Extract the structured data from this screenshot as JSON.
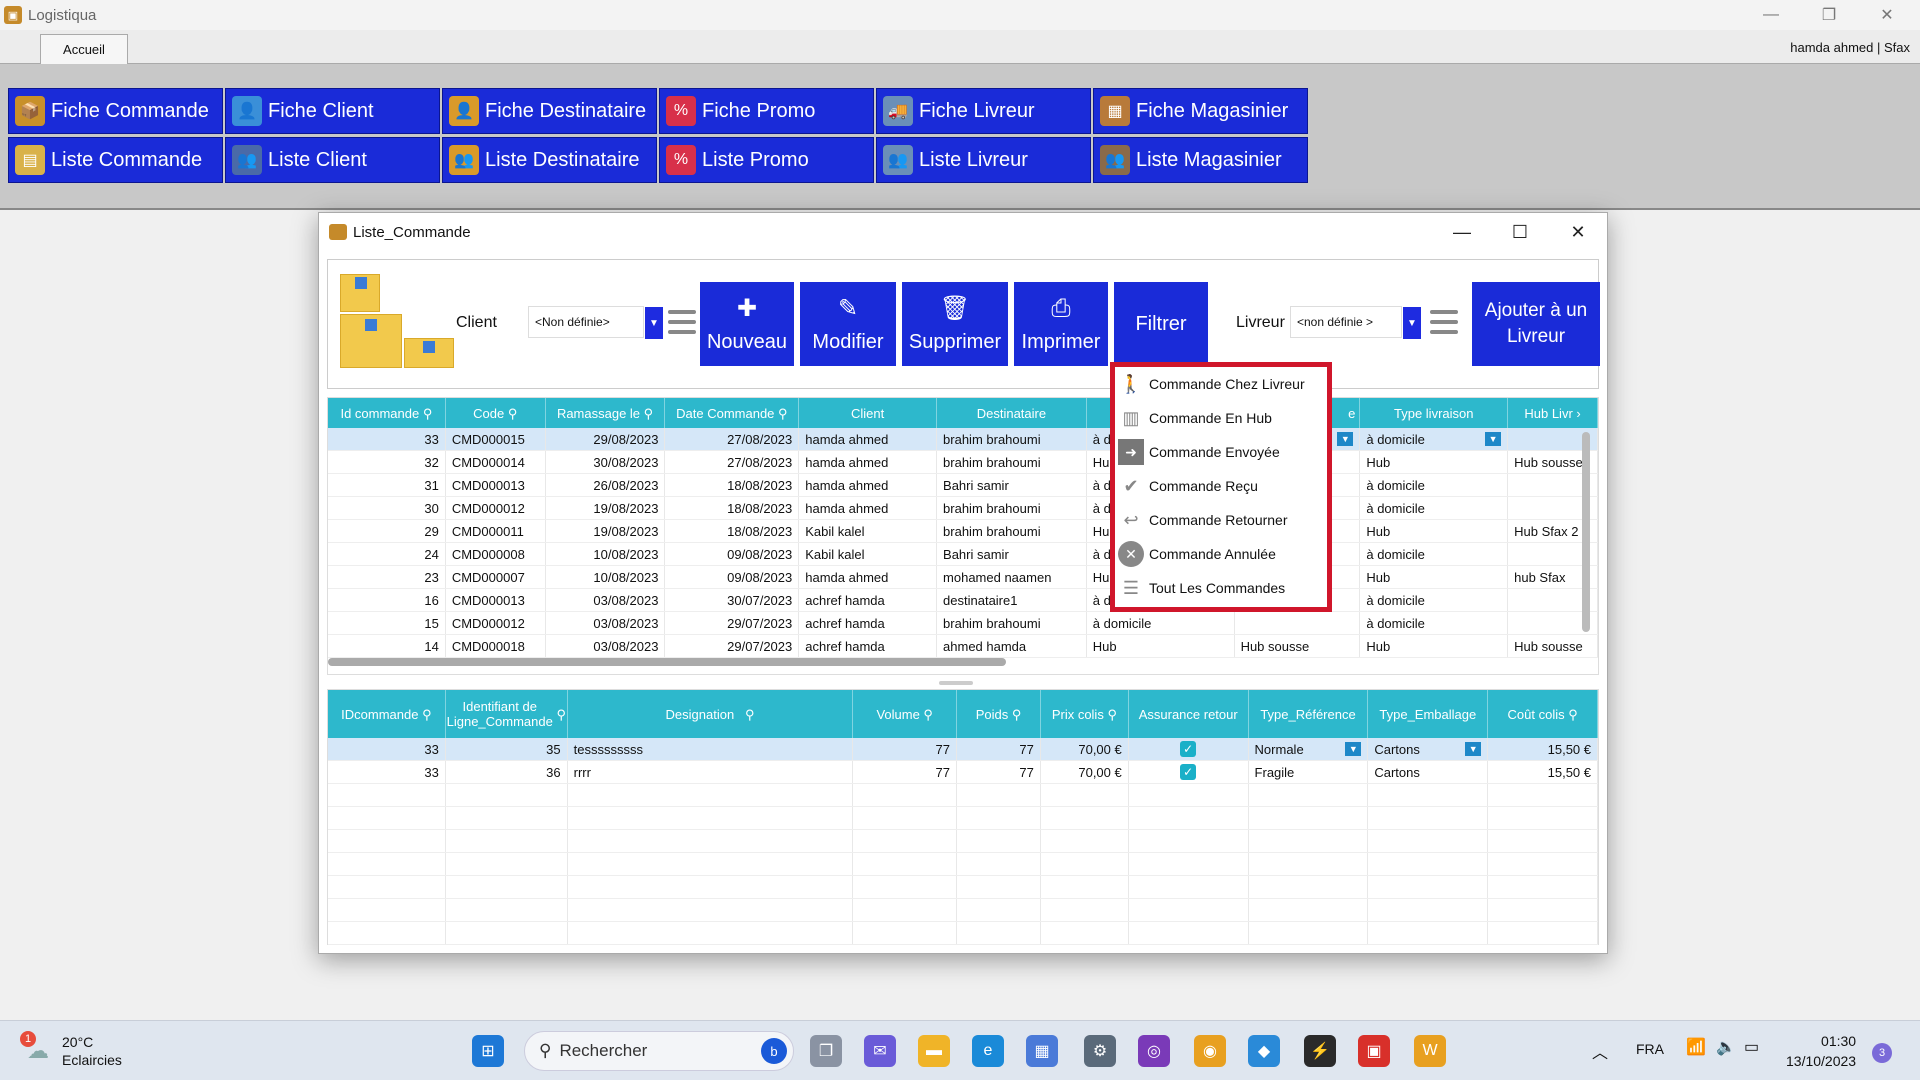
{
  "app": {
    "title": "Logistiqua",
    "tab": "Accueil",
    "user": "hamda ahmed | Sfax"
  },
  "ribbon": {
    "row1": [
      "Fiche Commande",
      "Fiche Client",
      "Fiche Destinataire",
      "Fiche Promo",
      "Fiche Livreur",
      "Fiche Magasinier"
    ],
    "row2": [
      "Liste Commande",
      "Liste Client",
      "Liste Destinataire",
      "Liste Promo",
      "Liste Livreur",
      "Liste Magasinier"
    ]
  },
  "window": {
    "title": "Liste_Commande"
  },
  "toolbar": {
    "client_label": "Client",
    "client_value": "<Non définie>",
    "livreur_label": "Livreur",
    "livreur_value": "<non définie >",
    "nouveau": "Nouveau",
    "modifier": "Modifier",
    "supprimer": "Supprimer",
    "imprimer": "Imprimer",
    "filtrer": "Filtrer",
    "ajouter_line1": "Ajouter à un",
    "ajouter_line2": "Livreur"
  },
  "orders": {
    "headers": [
      "Id commande",
      "Code",
      "Ramassage le",
      "Date Commande",
      "Client",
      "Destinataire",
      "",
      "",
      "Type livraison",
      "Hub Livr"
    ],
    "header_e": "e",
    "rows": [
      {
        "id": "33",
        "code": "CMD000015",
        "ram": "29/08/2023",
        "date": "27/08/2023",
        "client": "hamda ahmed",
        "dest": "brahim brahoumi",
        "c7": "à do",
        "c8": "",
        "type": "à domicile",
        "hub": ""
      },
      {
        "id": "32",
        "code": "CMD000014",
        "ram": "30/08/2023",
        "date": "27/08/2023",
        "client": "hamda ahmed",
        "dest": "brahim brahoumi",
        "c7": "Hub",
        "c8": "",
        "type": "Hub",
        "hub": "Hub sousse"
      },
      {
        "id": "31",
        "code": "CMD000013",
        "ram": "26/08/2023",
        "date": "18/08/2023",
        "client": "hamda ahmed",
        "dest": "Bahri samir",
        "c7": "à do",
        "c8": "",
        "type": "à domicile",
        "hub": ""
      },
      {
        "id": "30",
        "code": "CMD000012",
        "ram": "19/08/2023",
        "date": "18/08/2023",
        "client": "hamda ahmed",
        "dest": "brahim brahoumi",
        "c7": "à do",
        "c8": "",
        "type": "à domicile",
        "hub": ""
      },
      {
        "id": "29",
        "code": "CMD000011",
        "ram": "19/08/2023",
        "date": "18/08/2023",
        "client": "Kabil kalel",
        "dest": "brahim brahoumi",
        "c7": "Hub",
        "c8": "",
        "type": "Hub",
        "hub": "Hub Sfax 2"
      },
      {
        "id": "24",
        "code": "CMD000008",
        "ram": "10/08/2023",
        "date": "09/08/2023",
        "client": "Kabil kalel",
        "dest": "Bahri samir",
        "c7": "à do",
        "c8": "",
        "type": "à domicile",
        "hub": ""
      },
      {
        "id": "23",
        "code": "CMD000007",
        "ram": "10/08/2023",
        "date": "09/08/2023",
        "client": "hamda ahmed",
        "dest": "mohamed naamen",
        "c7": "Hub",
        "c8": "",
        "type": "Hub",
        "hub": "hub Sfax"
      },
      {
        "id": "16",
        "code": "CMD000013",
        "ram": "03/08/2023",
        "date": "30/07/2023",
        "client": "achref hamda",
        "dest": "destinataire1",
        "c7": "à do",
        "c8": "",
        "type": "à domicile",
        "hub": ""
      },
      {
        "id": "15",
        "code": "CMD000012",
        "ram": "03/08/2023",
        "date": "29/07/2023",
        "client": "achref hamda",
        "dest": "brahim brahoumi",
        "c7": "à domicile",
        "c8": "",
        "type": "à domicile",
        "hub": ""
      },
      {
        "id": "14",
        "code": "CMD000018",
        "ram": "03/08/2023",
        "date": "29/07/2023",
        "client": "achref hamda",
        "dest": "ahmed hamda",
        "c7": "Hub",
        "c8": "Hub sousse",
        "type": "Hub",
        "hub": "Hub sousse"
      }
    ]
  },
  "lines": {
    "headers": [
      "IDcommande",
      "Identifiant de Ligne_Commande",
      "Designation",
      "Volume",
      "Poids",
      "Prix colis",
      "Assurance retour",
      "Type_Référence",
      "Type_Emballage",
      "Coût colis"
    ],
    "rows": [
      {
        "id": "33",
        "ligne": "35",
        "des": "tesssssssss",
        "vol": "77",
        "poids": "77",
        "prix": "70,00 €",
        "ref": "Normale",
        "emb": "Cartons",
        "cout": "15,50 €"
      },
      {
        "id": "33",
        "ligne": "36",
        "des": "rrrr",
        "vol": "77",
        "poids": "77",
        "prix": "70,00 €",
        "ref": "Fragile",
        "emb": "Cartons",
        "cout": "15,50 €"
      }
    ]
  },
  "filter_menu": [
    "Commande Chez Livreur",
    "Commande En Hub",
    "Commande Envoyée",
    "Commande Reçu",
    "Commande Retourner",
    "Commande Annulée",
    "Tout Les Commandes"
  ],
  "taskbar": {
    "weather_temp": "20°C",
    "weather_desc": "Eclaircies",
    "weather_badge": "1",
    "search": "Rechercher",
    "lang": "FRA",
    "time": "01:30",
    "date": "13/10/2023",
    "notif": "3"
  }
}
